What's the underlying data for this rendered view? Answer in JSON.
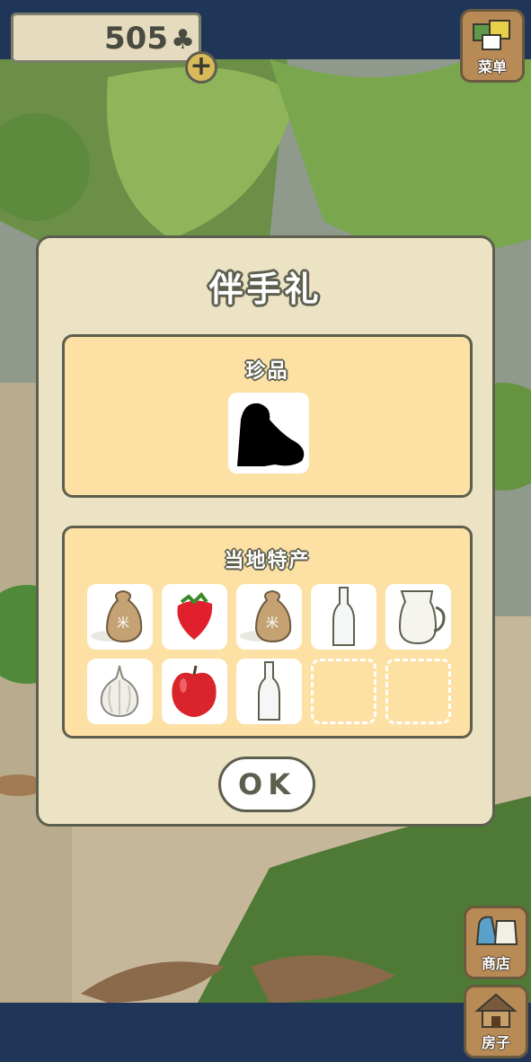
{
  "currency": {
    "amount": "505",
    "icon": "clover-icon",
    "add_label": "+"
  },
  "menu_button": {
    "label": "菜单"
  },
  "dialog": {
    "title": "伴手礼",
    "rare_section": {
      "label": "珍品",
      "items": [
        {
          "icon": "silhouette-unknown-icon"
        }
      ]
    },
    "local_section": {
      "label": "当地特产",
      "items": [
        {
          "icon": "rice-bag-icon"
        },
        {
          "icon": "strawberry-icon"
        },
        {
          "icon": "rice-bag-icon"
        },
        {
          "icon": "glass-bottle-icon"
        },
        {
          "icon": "milk-jug-icon"
        },
        {
          "icon": "garlic-icon"
        },
        {
          "icon": "apple-icon"
        },
        {
          "icon": "glass-bottle-icon"
        },
        {
          "icon": "empty-slot"
        },
        {
          "icon": "empty-slot"
        }
      ]
    },
    "ok_label": "OK"
  },
  "shop_button": {
    "label": "商店"
  },
  "house_button": {
    "label": "房子"
  }
}
